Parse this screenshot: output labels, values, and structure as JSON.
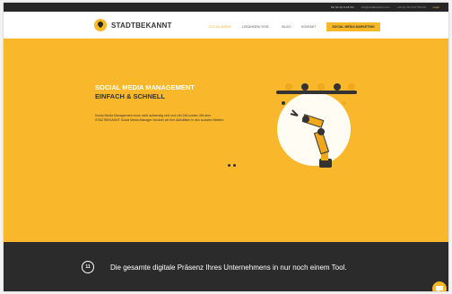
{
  "topbar": {
    "hours": "Mo bis Do 9-18 Uhr",
    "email": "info@stadtbekannt.com",
    "phone": "+49 (0) 221 9 87 654 30",
    "login": "Login"
  },
  "logo": {
    "brand": "STADTBEKANNT"
  },
  "nav": {
    "items": [
      "Social Media",
      "Lösungen/ Stat...",
      "Blog",
      "Kontakt"
    ],
    "cta": "Social Media Marketing"
  },
  "hero": {
    "title_line1": "Social Media Management",
    "title_line2": "Einfach & schnell",
    "text": "Social Media Management muss nicht aufwendig sein und viel Zeit kosten. Mit dem STADTBEKANNT Social Media Manager bündeln wir Ihre Aktivitäten in den sozialen Medien."
  },
  "bottombar": {
    "badge": "11",
    "claim": "Die gesamte digitale Präsenz Ihres Unternehmens in nur noch einem Tool."
  },
  "colors": {
    "accent": "#f9b72c",
    "dark": "#2b2b2b",
    "white": "#ffffff"
  },
  "icons": [
    "logo-pin-icon",
    "robot-arm-illustration",
    "chat-bubble-icon"
  ]
}
